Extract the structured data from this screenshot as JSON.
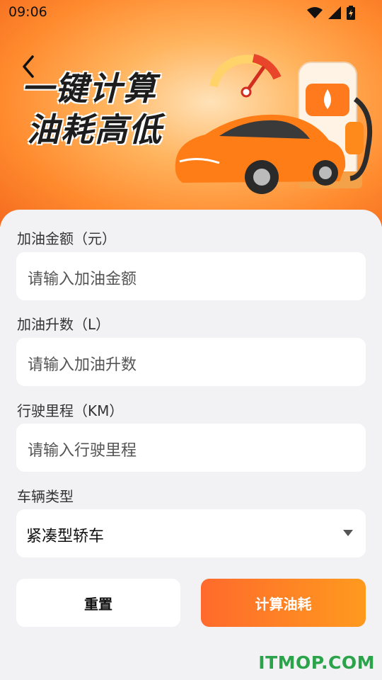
{
  "status_bar": {
    "time": "09:06"
  },
  "hero": {
    "title_line1": "一键计算",
    "title_line2": "油耗高低"
  },
  "form": {
    "amount": {
      "label": "加油金额（元）",
      "placeholder": "请输入加油金额"
    },
    "liters": {
      "label": "加油升数（L）",
      "placeholder": "请输入加油升数"
    },
    "distance": {
      "label": "行驶里程（KM）",
      "placeholder": "请输入行驶里程"
    },
    "vehicle": {
      "label": "车辆类型",
      "selected": "紧凑型轿车"
    }
  },
  "buttons": {
    "reset": "重置",
    "calculate": "计算油耗"
  },
  "watermark": "ITMOP.COM",
  "colors": {
    "accent_start": "#ff6a2c",
    "accent_end": "#ff9a1e",
    "watermark": "#2aa34a"
  }
}
